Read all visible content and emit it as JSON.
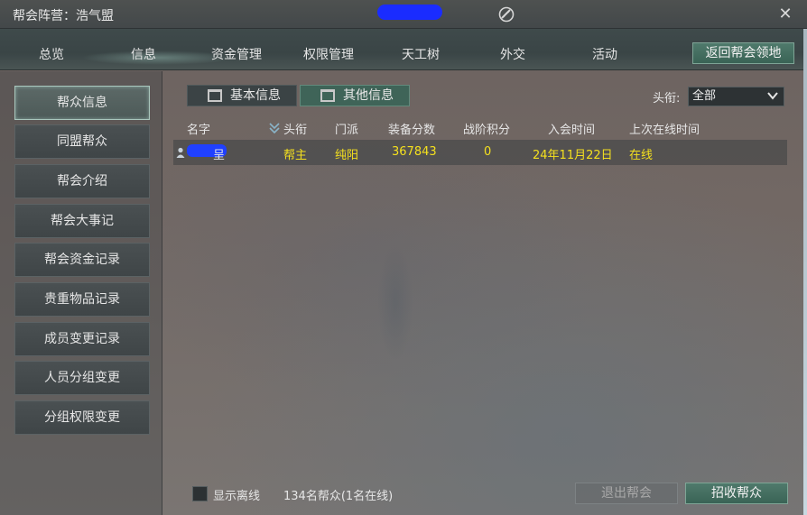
{
  "window": {
    "title": "帮会阵营：浩气盟",
    "close_symbol": "✕"
  },
  "nav": {
    "items": [
      "总览",
      "信息",
      "资金管理",
      "权限管理",
      "天工树",
      "外交",
      "活动"
    ],
    "return_label": "返回帮会领地"
  },
  "sidebar": {
    "items": [
      "帮众信息",
      "同盟帮众",
      "帮会介绍",
      "帮会大事记",
      "帮会资金记录",
      "贵重物品记录",
      "成员变更记录",
      "人员分组变更",
      "分组权限变更"
    ],
    "active_index": 0
  },
  "tabs": {
    "basic": "基本信息",
    "other": "其他信息",
    "active": "other"
  },
  "filter": {
    "label": "头衔:",
    "value": "全部"
  },
  "table": {
    "columns": [
      "名字",
      "头衔",
      "门派",
      "装备分数",
      "战阶积分",
      "入会时间",
      "上次在线时间"
    ],
    "rows": [
      {
        "name_visible_tail": "呈",
        "title": "帮主",
        "school": "纯阳",
        "gear_score": "367843",
        "rank_points": "0",
        "join_date": "24年11月22日",
        "last_online": "在线"
      }
    ]
  },
  "footer": {
    "show_offline_label": "显示离线",
    "member_count": "134名帮众(1名在线)",
    "quit_label": "退出帮会",
    "recruit_label": "招收帮众"
  },
  "colors": {
    "accent_green": "#3f6458",
    "highlight_text": "#f4e01e",
    "redaction_blue": "#1a2cff"
  }
}
